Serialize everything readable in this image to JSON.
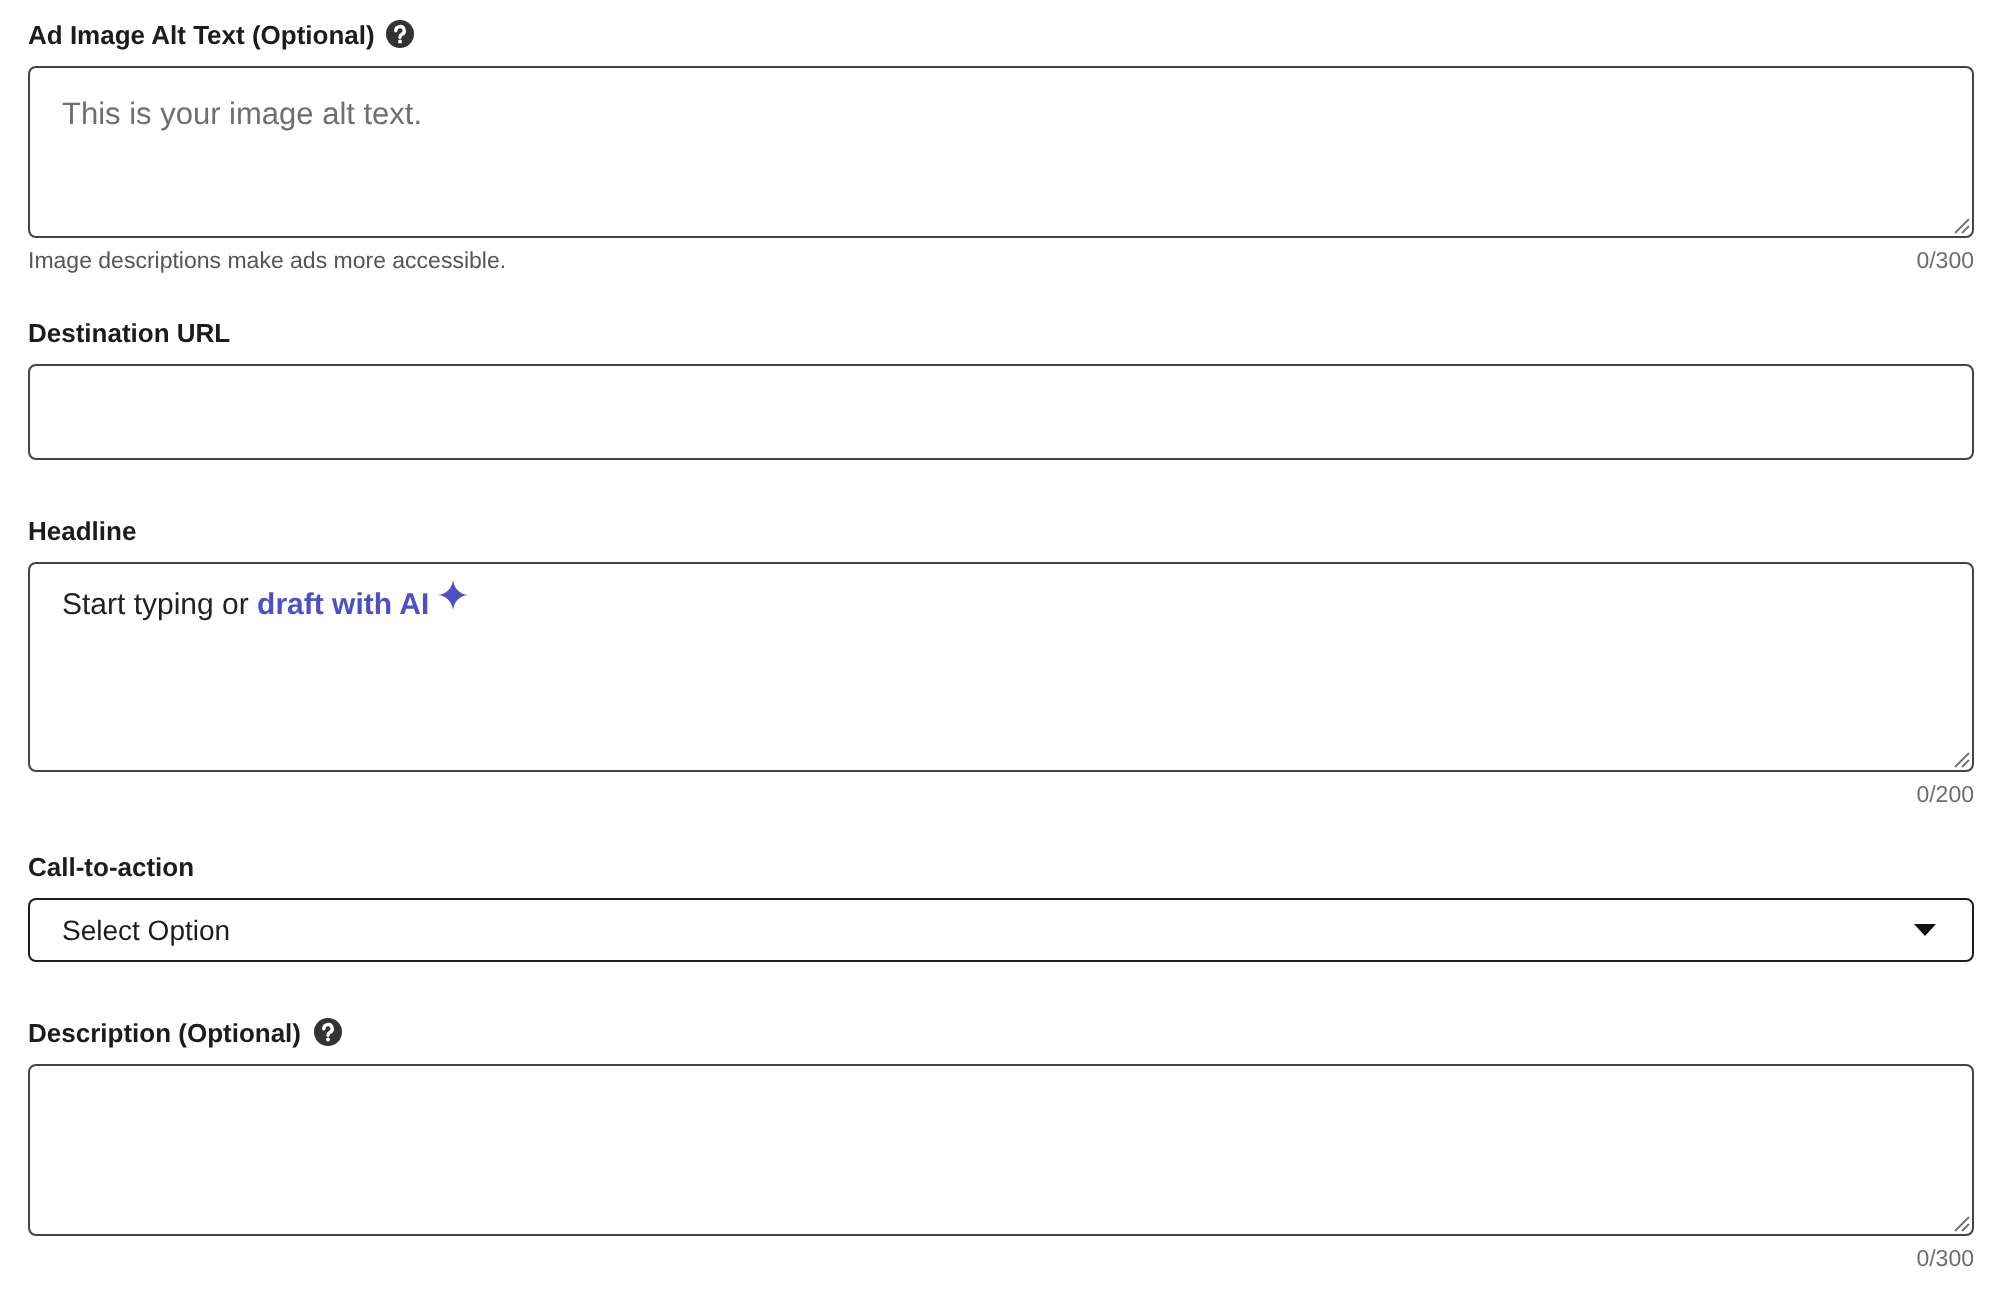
{
  "fields": [
    {
      "kind": "textarea",
      "label": "Ad Image Alt Text (Optional)",
      "help": true,
      "placeholder": "This is your image alt text.",
      "hint": "Image descriptions make ads more accessible.",
      "counter": "0/300"
    },
    {
      "kind": "input",
      "label": "Destination URL",
      "help": false
    },
    {
      "kind": "editor",
      "label": "Headline",
      "help": false,
      "prompt": "Start typing or",
      "link": "draft with AI",
      "counter": "0/200"
    },
    {
      "kind": "select",
      "label": "Call-to-action",
      "help": false,
      "value": "Select Option"
    },
    {
      "kind": "textarea",
      "label": "Description (Optional)",
      "help": true,
      "counter": "0/300"
    }
  ]
}
